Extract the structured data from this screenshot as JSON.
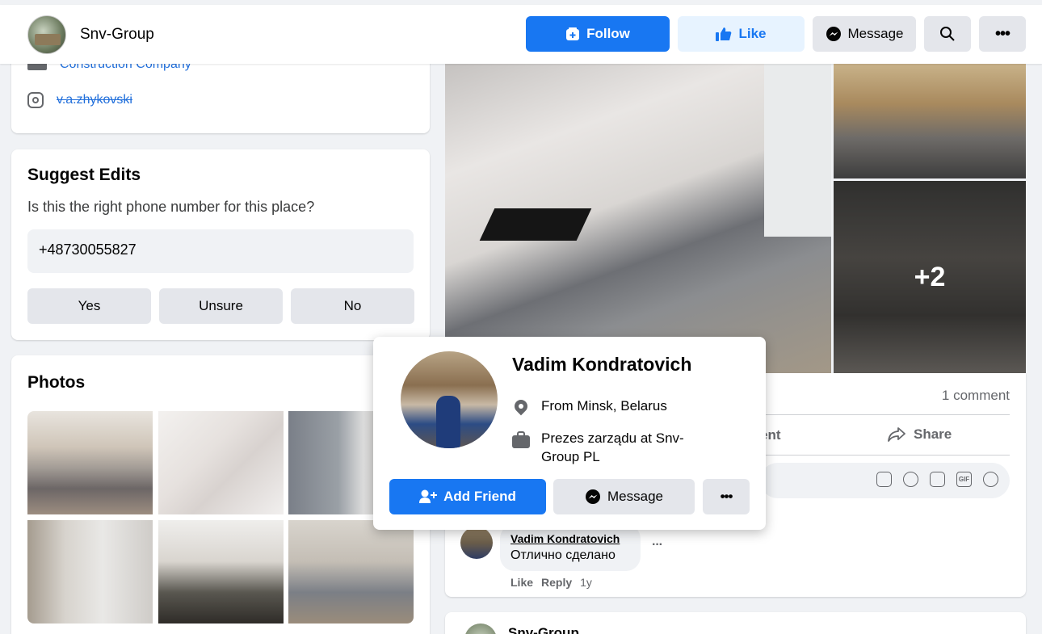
{
  "header": {
    "page_name": "Snv-Group",
    "follow_label": "Follow",
    "like_label": "Like",
    "message_label": "Message"
  },
  "intro": {
    "category": "Construction Company",
    "instagram": "v.a.zhykovski"
  },
  "suggest": {
    "title": "Suggest Edits",
    "question": "Is this the right phone number for this place?",
    "phone": "+48730055827",
    "yes": "Yes",
    "unsure": "Unsure",
    "no": "No"
  },
  "photos": {
    "title": "Photos"
  },
  "post": {
    "more_photos": "+2",
    "comment_count": "1 comment",
    "comment_action_partial": "ent",
    "share_label": "Share",
    "comment": {
      "author": "Vadim Kondratovich",
      "text": "Отлично сделано",
      "like": "Like",
      "reply": "Reply",
      "time": "1y"
    }
  },
  "next_post": {
    "name": "Snv-Group"
  },
  "hovercard": {
    "name": "Vadim Kondratovich",
    "from_prefix": "From ",
    "from_place": "Minsk, Belarus",
    "work": "Prezes zarządu at Snv-Group PL",
    "add_friend": "Add Friend",
    "message": "Message"
  },
  "colors": {
    "brand_blue": "#1877f2",
    "light_blue": "#e7f3ff",
    "button_gray": "#e4e6eb",
    "page_bg": "#f0f2f5"
  }
}
